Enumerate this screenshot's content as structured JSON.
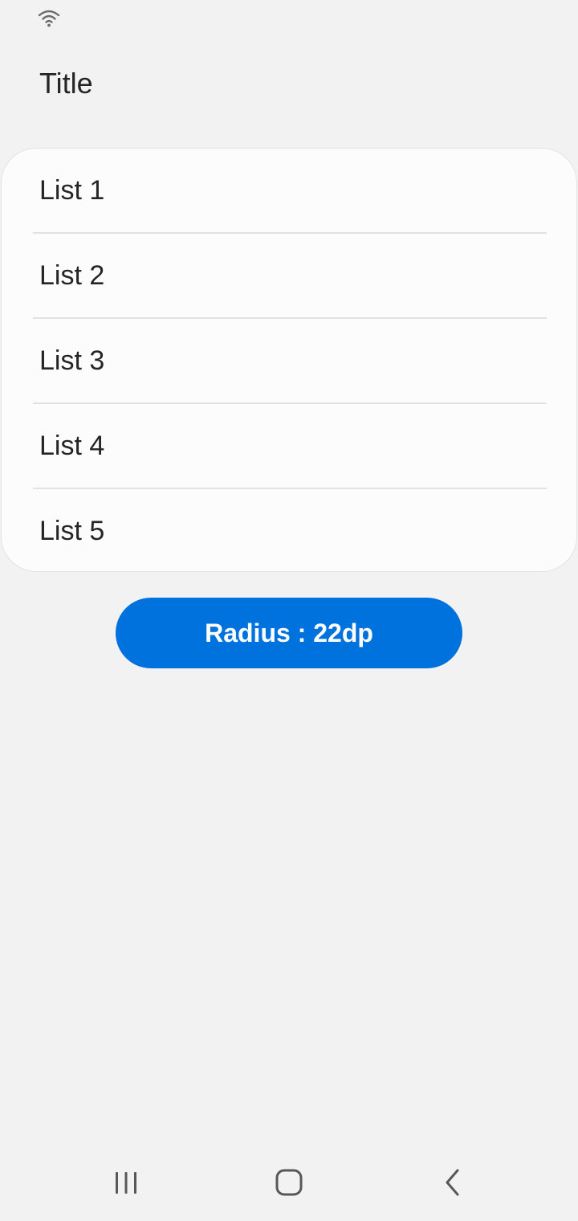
{
  "status_bar": {
    "icons": [
      "wifi-icon"
    ]
  },
  "header": {
    "title": "Title"
  },
  "list": {
    "items": [
      {
        "label": "List 1"
      },
      {
        "label": "List 2"
      },
      {
        "label": "List 3"
      },
      {
        "label": "List 4"
      },
      {
        "label": "List 5"
      }
    ]
  },
  "button": {
    "label": "Radius : 22dp",
    "color": "#0072de"
  },
  "nav_bar": {
    "icons": [
      "recent-apps-icon",
      "home-icon",
      "back-icon"
    ]
  }
}
